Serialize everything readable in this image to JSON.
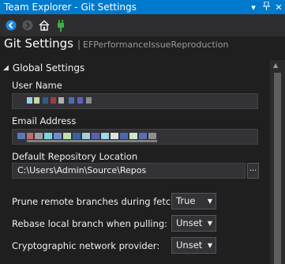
{
  "window": {
    "title": "Team Explorer - Git Settings",
    "controls": [
      {
        "name": "dropdown-icon",
        "glyph": "▾"
      },
      {
        "name": "pin-icon",
        "glyph": "⊥"
      },
      {
        "name": "close-icon",
        "glyph": "✕"
      }
    ]
  },
  "toolbar": {
    "icons": [
      "back-arrow-icon",
      "forward-arrow-icon",
      "home-icon",
      "connect-plug-icon"
    ]
  },
  "header": {
    "title": "Git Settings",
    "separator": "|",
    "repo": "EFPerformanceIssueReproduction"
  },
  "section": {
    "title": "Global Settings",
    "expanded": true
  },
  "fields": {
    "user_name": {
      "label": "User Name",
      "value": ""
    },
    "email": {
      "label": "Email Address",
      "value": ""
    },
    "repo_location": {
      "label": "Default Repository Location",
      "value": "C:\\Users\\Admin\\Source\\Repos",
      "browse": "..."
    }
  },
  "options": [
    {
      "label": "Prune remote branches during fetch:",
      "value": "True"
    },
    {
      "label": "Rebase local branch when pulling:",
      "value": "Unset"
    },
    {
      "label": "Cryptographic network provider:",
      "value": "Unset"
    }
  ],
  "colors": {
    "accent": "#007acc",
    "background": "#1f1f1f",
    "toolbar": "#2d2d30",
    "field": "#333337"
  }
}
